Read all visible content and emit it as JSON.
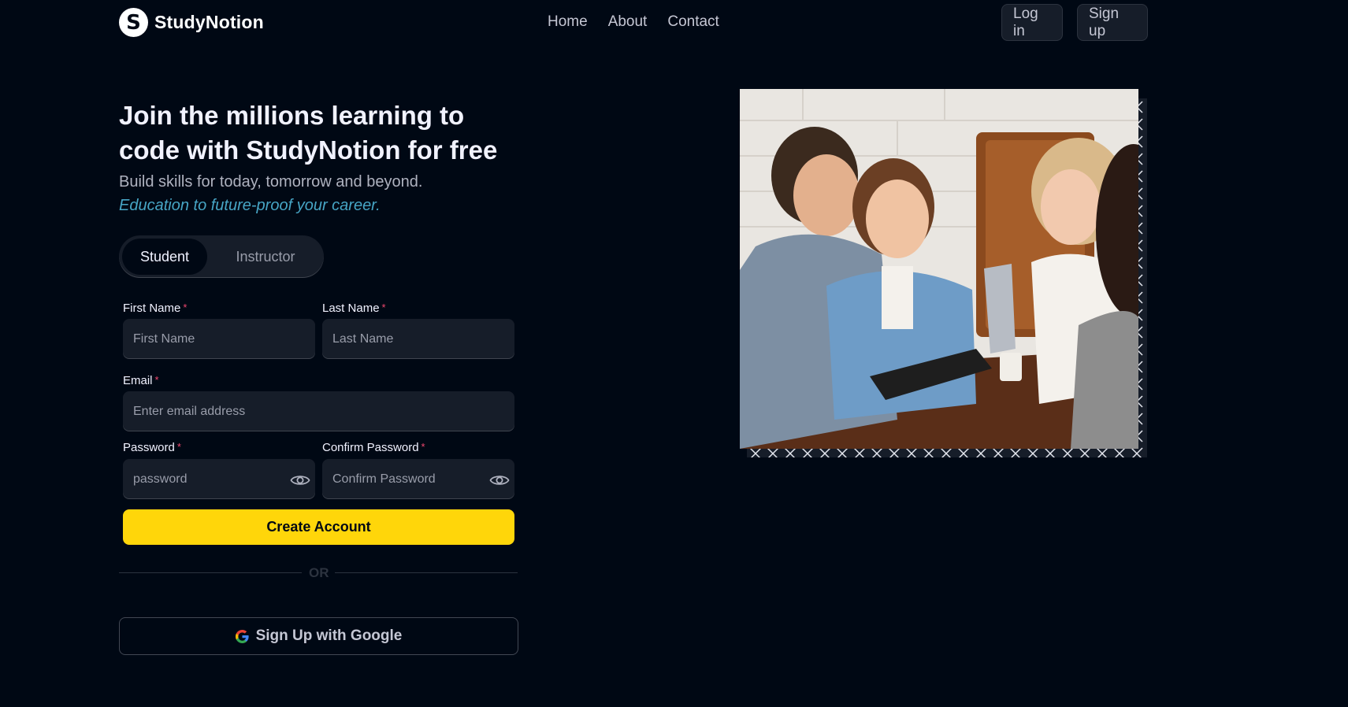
{
  "brand": {
    "name": "StudyNotion",
    "logo_letter": "S"
  },
  "nav": {
    "links": [
      "Home",
      "About",
      "Contact"
    ],
    "login_label": "Log in",
    "signup_label": "Sign up"
  },
  "hero": {
    "title": "Join the millions learning to code with StudyNotion for free",
    "subtitle": "Build skills for today, tomorrow and beyond.",
    "highlight": "Education to future-proof your career."
  },
  "role_toggle": {
    "selected": "Student",
    "options": [
      "Student",
      "Instructor"
    ]
  },
  "form": {
    "first_name": {
      "label": "First Name",
      "required_mark": "*",
      "placeholder": "First Name"
    },
    "last_name": {
      "label": "Last Name",
      "required_mark": "*",
      "placeholder": "Last Name"
    },
    "email": {
      "label": "Email",
      "required_mark": "*",
      "placeholder": "Enter email address"
    },
    "password": {
      "label": "Password",
      "required_mark": "*",
      "placeholder": "password"
    },
    "confirm_password": {
      "label": "Confirm Password",
      "required_mark": "*",
      "placeholder": "Confirm Password"
    },
    "submit_label": "Create Account"
  },
  "divider": {
    "text": "OR"
  },
  "google": {
    "label": "Sign Up with Google"
  },
  "colors": {
    "background": "#000814",
    "accent_yellow": "#FFD60A",
    "highlight_blue": "#47A5C5",
    "required_pink": "#EF476F",
    "input_bg": "#161D29"
  },
  "icons": [
    "eye-icon",
    "google-icon",
    "logo-icon"
  ]
}
